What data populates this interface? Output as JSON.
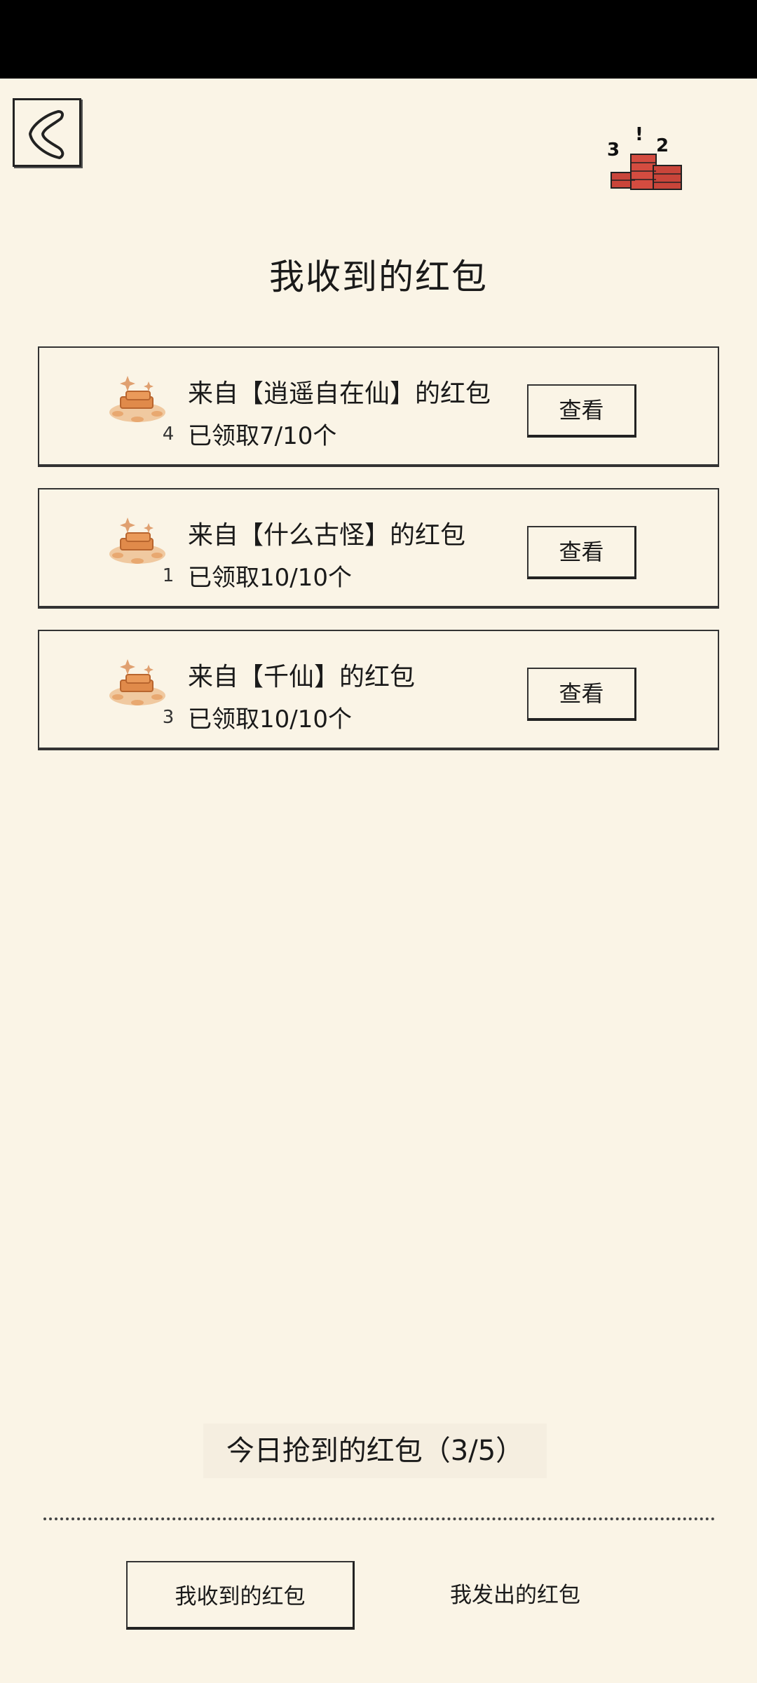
{
  "header": {
    "title": "我收到的红包",
    "back_icon": "back-chevron-icon",
    "corner_icon": "money-stack-icon",
    "corner_icon_digits": "3 ! 2"
  },
  "packets": [
    {
      "from": "来自【逍遥自在仙】的红包",
      "claimed": "已领取7/10个",
      "rank": "4",
      "button": "查看"
    },
    {
      "from": "来自【什么古怪】的红包",
      "claimed": "已领取10/10个",
      "rank": "1",
      "button": "查看"
    },
    {
      "from": "来自【千仙】的红包",
      "claimed": "已领取10/10个",
      "rank": "3",
      "button": "查看"
    }
  ],
  "footer": {
    "daily_count": "今日抢到的红包（3/5）",
    "tabs": [
      {
        "label": "我收到的红包",
        "active": true
      },
      {
        "label": "我发出的红包",
        "active": false
      }
    ]
  },
  "colors": {
    "background": "#faf4e6",
    "ink": "#1a1a1a",
    "packet_red": "#c9453a",
    "coin_orange": "#e08a4a"
  }
}
